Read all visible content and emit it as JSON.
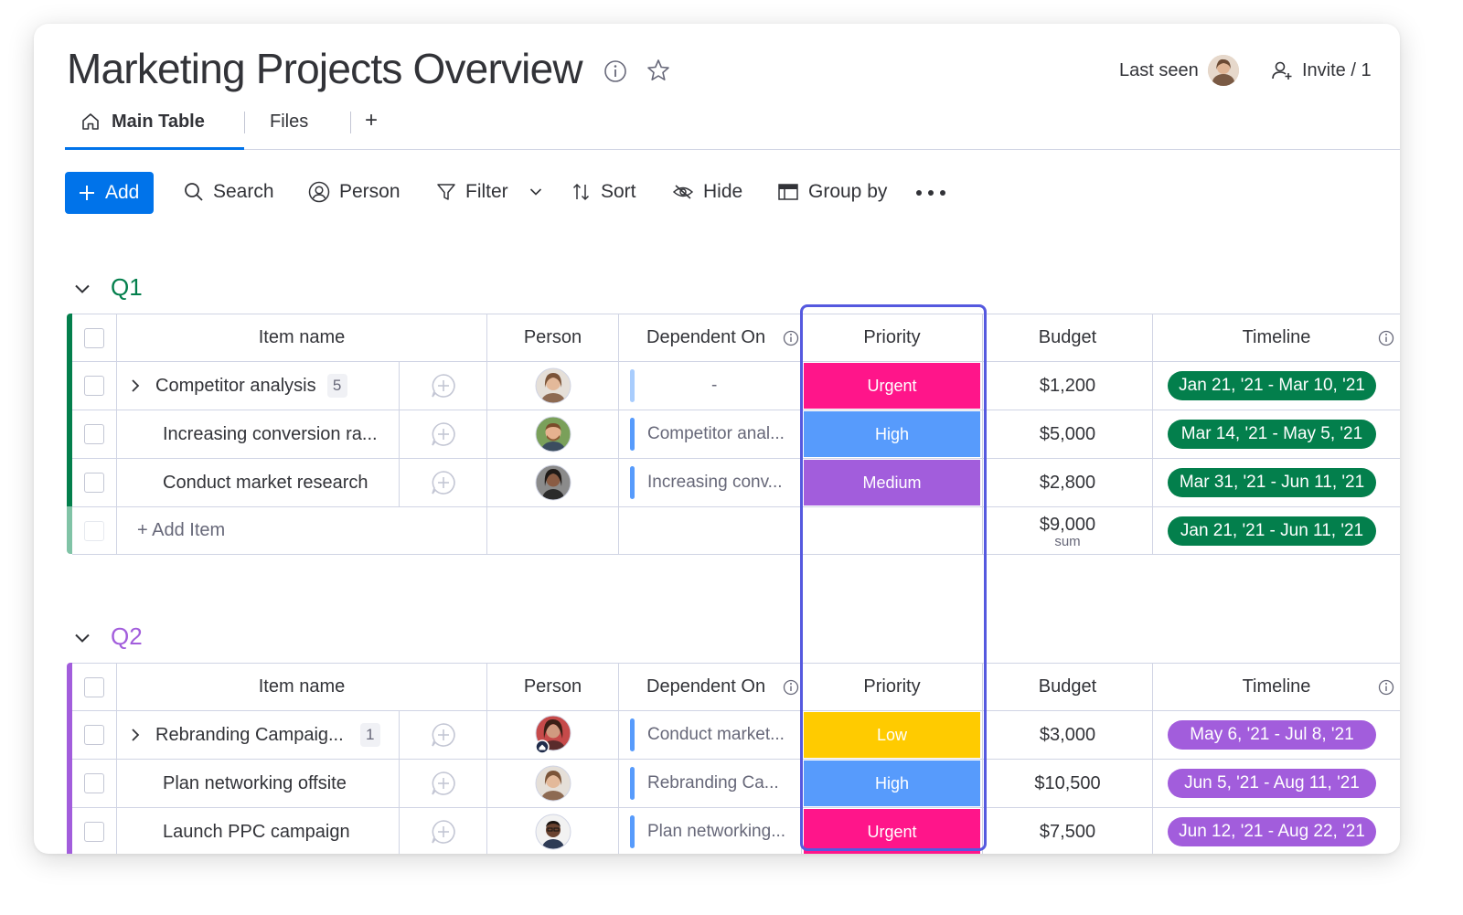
{
  "board": {
    "title": "Marketing Projects Overview",
    "last_seen_label": "Last seen",
    "invite_label": "Invite / 1"
  },
  "tabs": [
    {
      "label": "Main Table",
      "active": true
    },
    {
      "label": "Files",
      "active": false
    }
  ],
  "tabs_add": "+",
  "toolbar": {
    "add": "Add",
    "search": "Search",
    "person": "Person",
    "filter": "Filter",
    "sort": "Sort",
    "hide": "Hide",
    "group_by": "Group by"
  },
  "columns": {
    "item_name": "Item name",
    "person": "Person",
    "dependent_on": "Dependent On",
    "priority": "Priority",
    "budget": "Budget",
    "timeline": "Timeline"
  },
  "colors": {
    "accent": "#0073ea",
    "q1": "#037f4c",
    "q2": "#a25ddc",
    "urgent": "#ff158a",
    "high": "#579bfc",
    "medium": "#a25ddc",
    "low": "#ffcb00",
    "highlight": "#5559df"
  },
  "groups": [
    {
      "name": "Q1",
      "rows": [
        {
          "name": "Competitor analysis",
          "subitems": "5",
          "dependent": "-",
          "priority": "Urgent",
          "budget": "$1,200",
          "timeline": "Jan 21, '21 - Mar 10, '21"
        },
        {
          "name": "Increasing conversion ra...",
          "subitems": "",
          "dependent": "Competitor anal...",
          "priority": "High",
          "budget": "$5,000",
          "timeline": "Mar 14, '21 - May 5, '21"
        },
        {
          "name": "Conduct market research",
          "subitems": "",
          "dependent": "Increasing conv...",
          "priority": "Medium",
          "budget": "$2,800",
          "timeline": "Mar 31, '21 - Jun 11, '21"
        }
      ],
      "add_item": "+ Add Item",
      "sum_value": "$9,000",
      "sum_label": "sum",
      "sum_timeline": "Jan 21, '21 - Jun 11, '21"
    },
    {
      "name": "Q2",
      "rows": [
        {
          "name": "Rebranding Campaig...",
          "subitems": "1",
          "dependent": "Conduct market...",
          "priority": "Low",
          "budget": "$3,000",
          "timeline": "May 6, '21 - Jul 8, '21"
        },
        {
          "name": "Plan networking offsite",
          "subitems": "",
          "dependent": "Rebranding Ca...",
          "priority": "High",
          "budget": "$10,500",
          "timeline": "Jun 5, '21 - Aug 11, '21"
        },
        {
          "name": "Launch PPC campaign",
          "subitems": "",
          "dependent": "Plan networking...",
          "priority": "Urgent",
          "budget": "$7,500",
          "timeline": "Jun 12, '21 - Aug 22, '21"
        }
      ]
    }
  ]
}
